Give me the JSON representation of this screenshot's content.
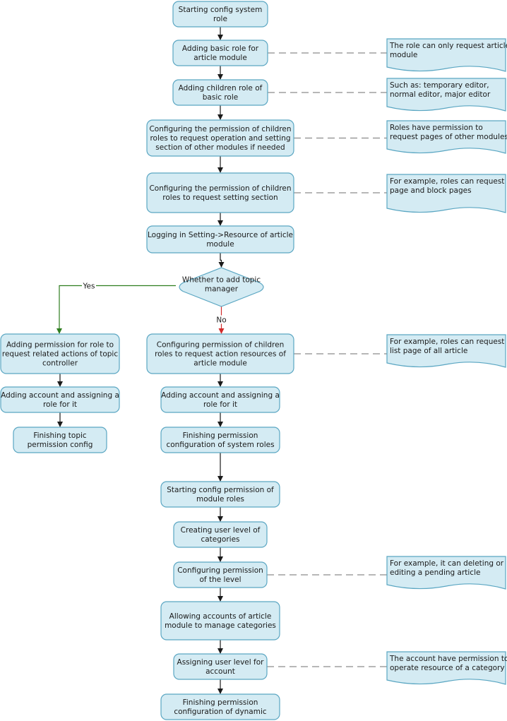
{
  "colors": {
    "node_fill": "#d4ebf3",
    "node_stroke": "#5aa6c2",
    "edge": "#1a1a1a",
    "yes_edge": "#2e7d1f",
    "no_edge": "#d22b2b",
    "dashed_connector": "#8c8c8c"
  },
  "nodes": [
    {
      "id": "n1",
      "shape": "process",
      "lines": [
        "Starting config system",
        "role"
      ]
    },
    {
      "id": "n2",
      "shape": "process",
      "lines": [
        "Adding basic role for",
        "article module"
      ]
    },
    {
      "id": "n3",
      "shape": "process",
      "lines": [
        "Adding children role of",
        "basic role"
      ]
    },
    {
      "id": "n4",
      "shape": "process",
      "lines": [
        "Configuring the permission of children",
        "roles to request operation and setting",
        "section of other modules if needed"
      ]
    },
    {
      "id": "n5",
      "shape": "process",
      "lines": [
        "Configuring the permission of children",
        "roles to request setting section"
      ]
    },
    {
      "id": "n6",
      "shape": "process",
      "lines": [
        "Logging in Setting->Resource of article",
        "module"
      ]
    },
    {
      "id": "d1",
      "shape": "decision",
      "lines": [
        "Whether to add topic",
        "manager"
      ]
    },
    {
      "id": "l1",
      "shape": "process",
      "lines": [
        "Adding permission for role to",
        "request related actions of topic",
        "controller"
      ]
    },
    {
      "id": "l2",
      "shape": "process",
      "lines": [
        "Adding account and assigning a",
        "role for it"
      ]
    },
    {
      "id": "l3",
      "shape": "process",
      "lines": [
        "Finishing topic",
        "permission config"
      ]
    },
    {
      "id": "n7",
      "shape": "process",
      "lines": [
        "Configuring permission of children",
        "roles to request action resources of",
        "article module"
      ]
    },
    {
      "id": "n8",
      "shape": "process",
      "lines": [
        "Adding account and assigning a",
        "role for it"
      ]
    },
    {
      "id": "n9",
      "shape": "process",
      "lines": [
        "Finishing permission",
        "configuration of system roles"
      ]
    },
    {
      "id": "n10",
      "shape": "process",
      "lines": [
        "Starting config permission of",
        "module roles"
      ]
    },
    {
      "id": "n11",
      "shape": "process",
      "lines": [
        "Creating user level of",
        "categories"
      ]
    },
    {
      "id": "n12",
      "shape": "process",
      "lines": [
        "Configuring permission",
        "of the level"
      ]
    },
    {
      "id": "n13",
      "shape": "process",
      "lines": [
        "Allowing accounts of article",
        "module  to manage categories"
      ]
    },
    {
      "id": "n14",
      "shape": "process",
      "lines": [
        "Assigning user level for",
        "account"
      ]
    },
    {
      "id": "n15",
      "shape": "process",
      "lines": [
        "Finishing permission",
        "configuration of dynamic"
      ]
    }
  ],
  "notes": [
    {
      "id": "c1",
      "attached_to": "n2",
      "lines": [
        "The role can only request article",
        "module"
      ]
    },
    {
      "id": "c2",
      "attached_to": "n3",
      "lines": [
        "Such as: temporary editor,",
        "normal editor, major editor"
      ]
    },
    {
      "id": "c3",
      "attached_to": "n4",
      "lines": [
        "Roles have permission to",
        "request pages of other modules"
      ]
    },
    {
      "id": "c4",
      "attached_to": "n5",
      "lines": [
        "For example, roles can request",
        "page and block pages"
      ]
    },
    {
      "id": "c5",
      "attached_to": "n7",
      "lines": [
        "For example, roles can request",
        "list page of all article"
      ]
    },
    {
      "id": "c6",
      "attached_to": "n12",
      "lines": [
        "For example, it can deleting or",
        "editing a pending article"
      ]
    },
    {
      "id": "c7",
      "attached_to": "n14",
      "lines": [
        "The account have permission to",
        "operate resource of a category"
      ]
    }
  ],
  "edges": [
    {
      "from": "n1",
      "to": "n2",
      "label": ""
    },
    {
      "from": "n2",
      "to": "n3",
      "label": ""
    },
    {
      "from": "n3",
      "to": "n4",
      "label": ""
    },
    {
      "from": "n4",
      "to": "n5",
      "label": ""
    },
    {
      "from": "n5",
      "to": "n6",
      "label": ""
    },
    {
      "from": "n6",
      "to": "d1",
      "label": ""
    },
    {
      "from": "d1",
      "to": "l1",
      "label": "Yes",
      "kind": "yes"
    },
    {
      "from": "d1",
      "to": "n7",
      "label": "No",
      "kind": "no"
    },
    {
      "from": "l1",
      "to": "l2",
      "label": ""
    },
    {
      "from": "l2",
      "to": "l3",
      "label": ""
    },
    {
      "from": "n7",
      "to": "n8",
      "label": ""
    },
    {
      "from": "n8",
      "to": "n9",
      "label": ""
    },
    {
      "from": "n9",
      "to": "n10",
      "label": ""
    },
    {
      "from": "n10",
      "to": "n11",
      "label": ""
    },
    {
      "from": "n11",
      "to": "n12",
      "label": ""
    },
    {
      "from": "n12",
      "to": "n13",
      "label": ""
    },
    {
      "from": "n13",
      "to": "n14",
      "label": ""
    },
    {
      "from": "n14",
      "to": "n15",
      "label": ""
    }
  ]
}
